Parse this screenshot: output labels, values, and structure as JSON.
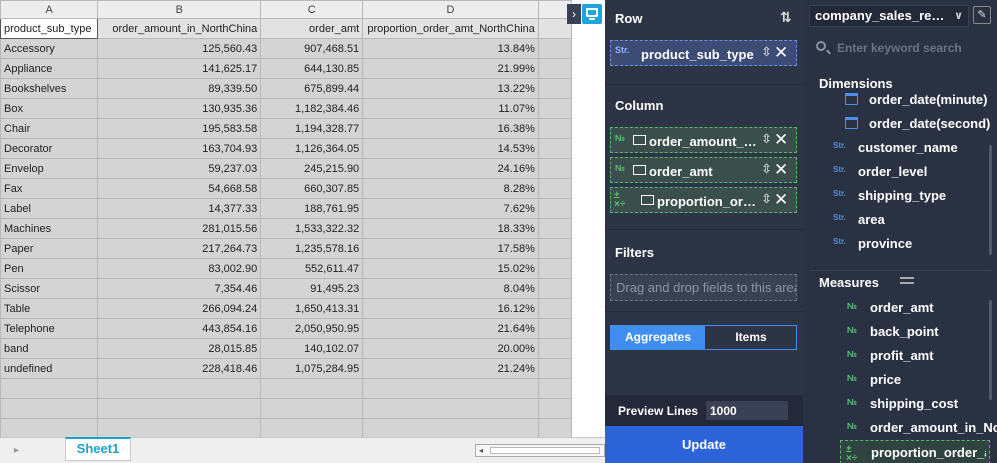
{
  "sheet": {
    "columns": [
      "A",
      "B",
      "C",
      "D",
      ""
    ],
    "header_row": [
      "product_sub_type",
      "order_amount_in_NorthChina",
      "order_amt",
      "proportion_order_amt_NorthChina",
      ""
    ],
    "rows": [
      [
        "Accessory",
        "125,560.43",
        "907,468.51",
        "13.84%"
      ],
      [
        "Appliance",
        "141,625.17",
        "644,130.85",
        "21.99%"
      ],
      [
        "Bookshelves",
        "89,339.50",
        "675,899.44",
        "13.22%"
      ],
      [
        "Box",
        "130,935.36",
        "1,182,384.46",
        "11.07%"
      ],
      [
        "Chair",
        "195,583.58",
        "1,194,328.77",
        "16.38%"
      ],
      [
        "Decorator",
        "163,704.93",
        "1,126,364.05",
        "14.53%"
      ],
      [
        "Envelop",
        "59,237.03",
        "245,215.90",
        "24.16%"
      ],
      [
        "Fax",
        "54,668.58",
        "660,307.85",
        "8.28%"
      ],
      [
        "Label",
        "14,377.33",
        "188,761.95",
        "7.62%"
      ],
      [
        "Machines",
        "281,015.56",
        "1,533,322.32",
        "18.33%"
      ],
      [
        "Paper",
        "217,264.73",
        "1,235,578.16",
        "17.58%"
      ],
      [
        "Pen",
        "83,002.90",
        "552,611.47",
        "15.02%"
      ],
      [
        "Scissor",
        "7,354.46",
        "91,495.23",
        "8.04%"
      ],
      [
        "Table",
        "266,094.24",
        "1,650,413.31",
        "16.12%"
      ],
      [
        "Telephone",
        "443,854.16",
        "2,050,950.95",
        "21.64%"
      ],
      [
        "band",
        "28,015.85",
        "140,102.07",
        "20.00%"
      ],
      [
        "undefined",
        "228,418.46",
        "1,075,284.95",
        "21.24%"
      ]
    ],
    "tab": "Sheet1"
  },
  "config": {
    "row_title": "Row",
    "row_fields": [
      {
        "type": "Str.",
        "label": "product_sub_type"
      }
    ],
    "column_title": "Column",
    "column_fields": [
      {
        "type": "№",
        "label": "order_amount_in_NorthChina"
      },
      {
        "type": "№",
        "label": "order_amt"
      },
      {
        "type": "fx",
        "label": "proportion_order_amt_NorthChina"
      }
    ],
    "filters_title": "Filters",
    "filters_placeholder": "Drag and drop fields to this area",
    "aggregates_label": "Aggregates",
    "items_label": "Items",
    "preview_label": "Preview Lines",
    "preview_value": "1000",
    "update_label": "Update"
  },
  "fields": {
    "datasource": "company_sales_record",
    "search_placeholder": "Enter keyword search",
    "dimensions_title": "Dimensions",
    "dimensions": [
      {
        "type": "date",
        "name": "order_date(minute)"
      },
      {
        "type": "date",
        "name": "order_date(second)"
      },
      {
        "type": "Str.",
        "name": "customer_name"
      },
      {
        "type": "Str.",
        "name": "order_level"
      },
      {
        "type": "Str.",
        "name": "shipping_type"
      },
      {
        "type": "Str.",
        "name": "area"
      },
      {
        "type": "Str.",
        "name": "province"
      }
    ],
    "measures_title": "Measures",
    "measures": [
      {
        "type": "№",
        "name": "order_amt"
      },
      {
        "type": "№",
        "name": "back_point"
      },
      {
        "type": "№",
        "name": "profit_amt"
      },
      {
        "type": "№",
        "name": "price"
      },
      {
        "type": "№",
        "name": "shipping_cost"
      },
      {
        "type": "№",
        "name": "order_amount_in_NorthChina"
      },
      {
        "type": "fx",
        "name": "proportion_order_amt_NorthChina"
      }
    ]
  },
  "icons": {
    "row_sort": "swap-vertical-icon",
    "remove": "close-icon",
    "sort": "sort-icon",
    "chart": "chart-icon",
    "search": "search-icon",
    "edit": "edit-icon"
  },
  "colors": {
    "panel_bg": "#2d3445",
    "accent_blue": "#3f8ef0",
    "update_blue": "#2c63d9",
    "measure_green": "#59c16c",
    "dimension_blue": "#4f8fe6",
    "tab_cyan": "#1aa3c7"
  }
}
